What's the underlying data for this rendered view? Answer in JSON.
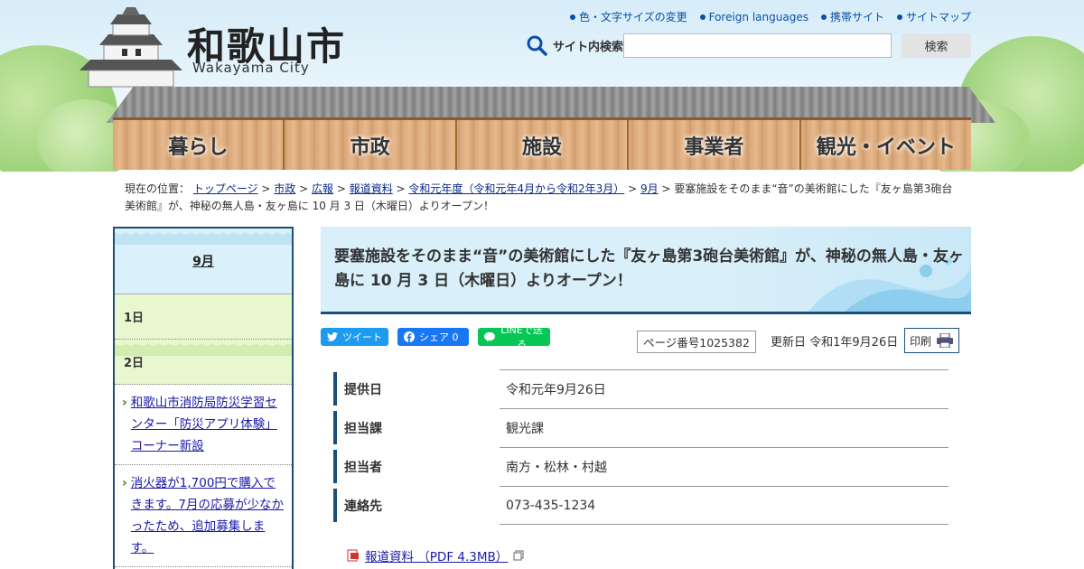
{
  "header": {
    "city_name": "和歌山市",
    "city_name_en": "Wakayama City",
    "top_links": [
      "色・文字サイズの変更",
      "Foreign languages",
      "携帯サイト",
      "サイトマップ"
    ],
    "search_label": "サイト内検索",
    "search_value": "",
    "search_button": "検索"
  },
  "nav": [
    "暮らし",
    "市政",
    "施設",
    "事業者",
    "観光・イベント"
  ],
  "breadcrumb": {
    "prefix": "現在の位置：",
    "links": [
      "トップページ",
      "市政",
      "広報",
      "報道資料",
      "令和元年度（令和元年4月から令和2年3月）",
      "9月"
    ],
    "current": "要塞施設をそのまま“音”の美術館にした『友ヶ島第3砲台美術館』が、神秘の無人島・友ヶ島に 10 月 3 日（木曜日）よりオープン！"
  },
  "sidebar": {
    "month": "9月",
    "days": [
      "1日",
      "2日"
    ],
    "links": [
      "和歌山市消防局防災学習センター「防災アプリ体験」コーナー新設",
      "消火器が1,700円で購入できます。7月の応募が少なかったため、追加募集します。"
    ]
  },
  "article": {
    "title": "要塞施設をそのまま“音”の美術館にした『友ヶ島第3砲台美術館』が、神秘の無人島・友ヶ島に 10 月 3 日（木曜日）よりオープン！",
    "share": {
      "tweet": "ツイート",
      "facebook": "シェア 0",
      "line": "LINEで送る"
    },
    "page_number": "ページ番号1025382",
    "updated": "更新日 令和1年9月26日",
    "print": "印刷",
    "info": [
      {
        "key": "提供日",
        "value": "令和元年9月26日"
      },
      {
        "key": "担当課",
        "value": "観光課"
      },
      {
        "key": "担当者",
        "value": "南方・松林・村越"
      },
      {
        "key": "連絡先",
        "value": "073-435-1234"
      }
    ],
    "pdf_link": "報道資料 （PDF 4.3MB）"
  }
}
